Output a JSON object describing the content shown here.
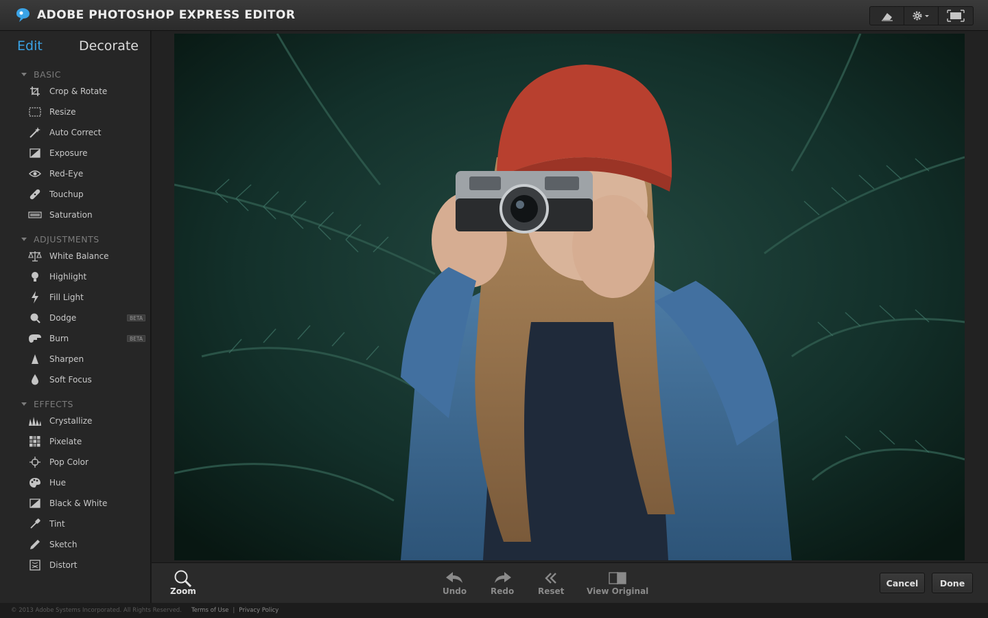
{
  "app": {
    "title": "ADOBE PHOTOSHOP EXPRESS EDITOR"
  },
  "toolbar": {
    "icons": [
      "eraser-icon",
      "gear-icon",
      "fullscreen-icon"
    ]
  },
  "tabs": {
    "edit": "Edit",
    "decorate": "Decorate",
    "active": "edit"
  },
  "sections": {
    "basic": {
      "title": "BASIC",
      "items": [
        {
          "label": "Crop & Rotate",
          "icon": "crop-icon"
        },
        {
          "label": "Resize",
          "icon": "resize-icon"
        },
        {
          "label": "Auto Correct",
          "icon": "magic-wand-icon"
        },
        {
          "label": "Exposure",
          "icon": "exposure-icon"
        },
        {
          "label": "Red-Eye",
          "icon": "eye-icon"
        },
        {
          "label": "Touchup",
          "icon": "bandage-icon"
        },
        {
          "label": "Saturation",
          "icon": "saturation-icon"
        }
      ]
    },
    "adjustments": {
      "title": "ADJUSTMENTS",
      "items": [
        {
          "label": "White Balance",
          "icon": "scale-icon"
        },
        {
          "label": "Highlight",
          "icon": "bulb-icon"
        },
        {
          "label": "Fill Light",
          "icon": "lightning-icon"
        },
        {
          "label": "Dodge",
          "icon": "dodge-icon",
          "badge": "BETA"
        },
        {
          "label": "Burn",
          "icon": "burn-icon",
          "badge": "BETA"
        },
        {
          "label": "Sharpen",
          "icon": "sharpen-icon"
        },
        {
          "label": "Soft Focus",
          "icon": "drop-icon"
        }
      ]
    },
    "effects": {
      "title": "EFFECTS",
      "items": [
        {
          "label": "Crystallize",
          "icon": "crystallize-icon"
        },
        {
          "label": "Pixelate",
          "icon": "pixelate-icon"
        },
        {
          "label": "Pop Color",
          "icon": "target-icon"
        },
        {
          "label": "Hue",
          "icon": "palette-icon"
        },
        {
          "label": "Black & White",
          "icon": "bw-icon"
        },
        {
          "label": "Tint",
          "icon": "dropper-icon"
        },
        {
          "label": "Sketch",
          "icon": "pencil-icon"
        },
        {
          "label": "Distort",
          "icon": "distort-icon"
        }
      ]
    }
  },
  "bottom": {
    "zoom": "Zoom",
    "undo": "Undo",
    "redo": "Redo",
    "reset": "Reset",
    "view_original": "View Original",
    "cancel": "Cancel",
    "done": "Done"
  },
  "footer": {
    "copyright": "© 2013 Adobe Systems Incorporated. All Rights Reserved.",
    "terms": "Terms of Use",
    "separator": "|",
    "privacy": "Privacy Policy"
  },
  "colors": {
    "accent": "#3aa3e6",
    "beanie": "#b8402f",
    "denim": "#3a6690",
    "foliage": "#1d3a34"
  }
}
